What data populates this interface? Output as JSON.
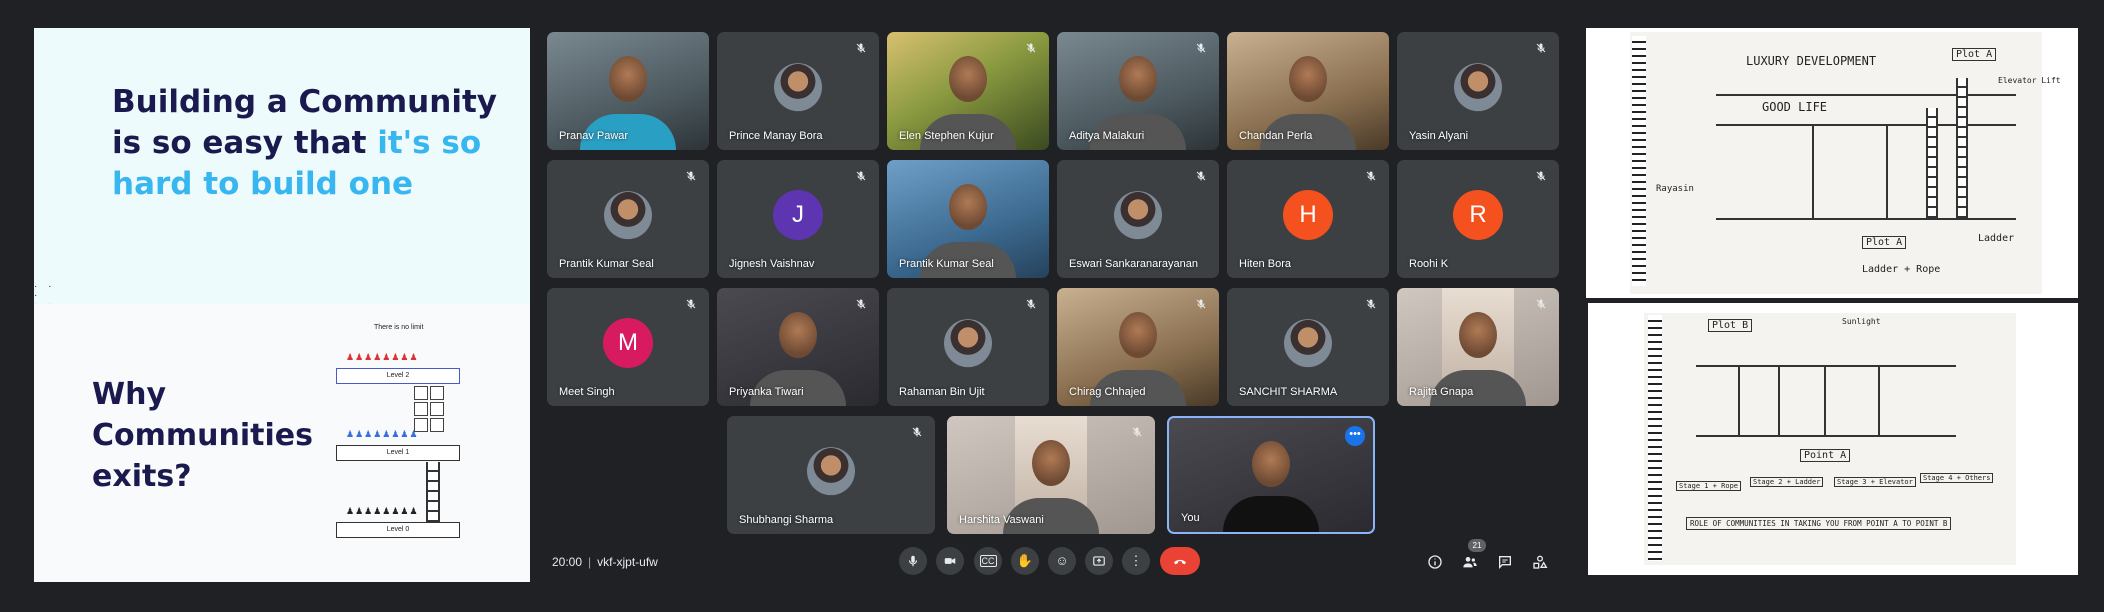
{
  "slides": {
    "slide1": {
      "title_part1": "Building a Community is so easy that ",
      "title_highlight": "it's so hard to build one"
    },
    "slide2": {
      "title": "Why Communities exits?",
      "caption": "There is no limit",
      "levels": [
        "Level 2",
        "Level 1",
        "Level 0"
      ]
    }
  },
  "participants": [
    {
      "name": "Pranav Pawar",
      "muted": false,
      "type": "video"
    },
    {
      "name": "Prince Manay Bora",
      "muted": true,
      "type": "photo"
    },
    {
      "name": "Elen Stephen Kujur",
      "muted": true,
      "type": "video"
    },
    {
      "name": "Aditya Malakuri",
      "muted": true,
      "type": "video"
    },
    {
      "name": "Chandan Perla",
      "muted": false,
      "type": "video"
    },
    {
      "name": "Yasin Alyani",
      "muted": true,
      "type": "photo"
    },
    {
      "name": "Prantik Kumar Seal",
      "muted": true,
      "type": "photo"
    },
    {
      "name": "Jignesh Vaishnav",
      "muted": true,
      "type": "avatar",
      "initial": "J",
      "color": "#5e35b1"
    },
    {
      "name": "Prantik Kumar Seal",
      "muted": false,
      "type": "video"
    },
    {
      "name": "Eswari Sankaranarayanan",
      "muted": true,
      "type": "photo"
    },
    {
      "name": "Hiten Bora",
      "muted": true,
      "type": "avatar",
      "initial": "H",
      "color": "#f4511e"
    },
    {
      "name": "Roohi K",
      "muted": true,
      "type": "avatar",
      "initial": "R",
      "color": "#f4511e"
    },
    {
      "name": "Meet Singh",
      "muted": true,
      "type": "avatar",
      "initial": "M",
      "color": "#d81b60"
    },
    {
      "name": "Priyanka Tiwari",
      "muted": true,
      "type": "video"
    },
    {
      "name": "Rahaman Bin Ujit",
      "muted": true,
      "type": "photo"
    },
    {
      "name": "Chirag Chhajed",
      "muted": true,
      "type": "video"
    },
    {
      "name": "SANCHIT SHARMA",
      "muted": true,
      "type": "photo"
    },
    {
      "name": "Rajita Gnapa",
      "muted": true,
      "type": "video"
    },
    {
      "name": "Shubhangi Sharma",
      "muted": true,
      "type": "photo"
    },
    {
      "name": "Harshita Vaswani",
      "muted": true,
      "type": "video"
    },
    {
      "name": "You",
      "muted": false,
      "type": "video"
    }
  ],
  "meeting": {
    "time": "20:00",
    "code": "vkf-xjpt-ufw",
    "participant_count": "21"
  },
  "controls": {
    "mic_icon": "mic-icon",
    "camera_icon": "camera-icon",
    "captions_icon": "captions-icon",
    "hand_icon": "raise-hand-icon",
    "emoji_icon": "emoji-icon",
    "present_icon": "present-screen-icon",
    "more_icon": "more-options-icon",
    "end_icon": "end-call-icon",
    "captions_label": "CC"
  },
  "notes": {
    "note1": {
      "title": "LUXURY",
      "title2": "DEVELOPMENT",
      "tag": "Plot A",
      "label_goodlife": "GOOD LIFE",
      "label_elevator": "Elevator Lift",
      "label_ladder": "Ladder",
      "label_ladder_rope": "Ladder + Rope",
      "label_plota": "Plot A",
      "label_left": "Rayasin"
    },
    "note2": {
      "label_plotb": "Plot B",
      "label_sunlight": "Sunlight",
      "caption": "ROLE OF COMMUNITIES IN TAKING YOU FROM POINT A TO POINT B",
      "label_plota": "Point A",
      "stages": [
        "Stage 1 + Rope",
        "Stage 2 + Ladder",
        "Stage 3 + Elevator",
        "Stage 4 + Others"
      ]
    }
  }
}
